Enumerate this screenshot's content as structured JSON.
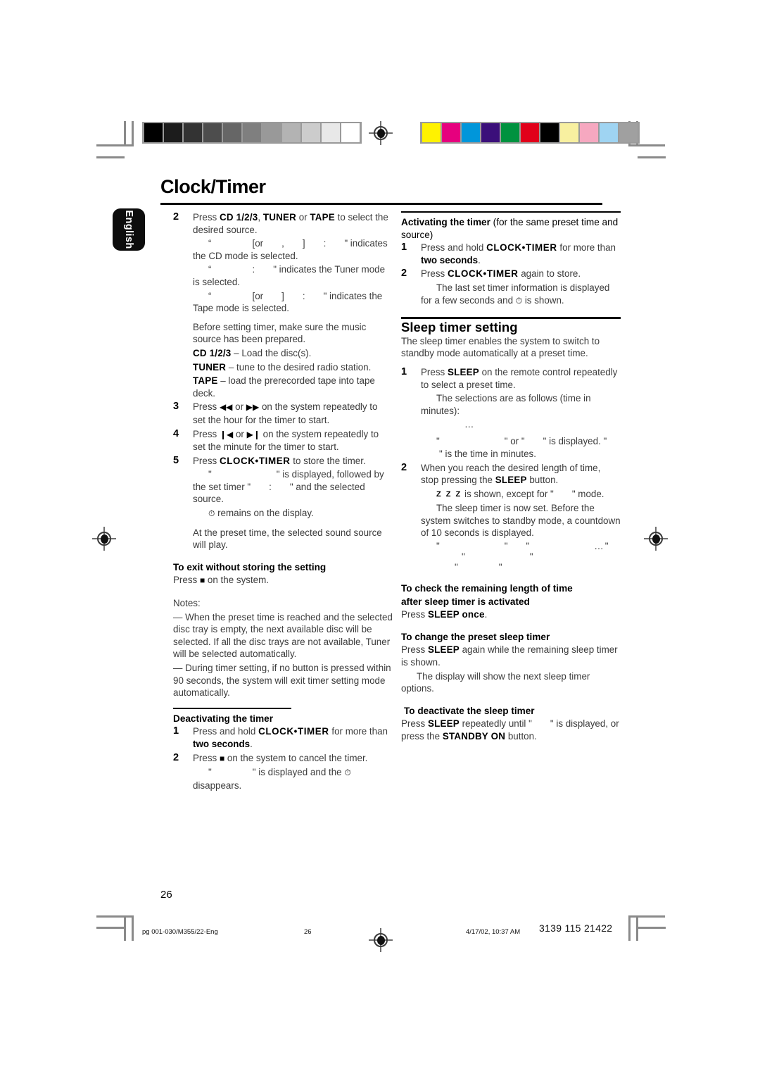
{
  "document": {
    "title": "Clock/Timer",
    "language_tab": "English",
    "page_number": "26"
  },
  "calibration": {
    "grayscale": [
      "#000000",
      "#1c1c1c",
      "#333333",
      "#4d4d4d",
      "#666666",
      "#7f7f7f",
      "#999999",
      "#b3b3b3",
      "#cccccc",
      "#e8e8e8",
      "#ffffff"
    ],
    "colors": [
      "#fff200",
      "#e6007e",
      "#0096da",
      "#3b0f7a",
      "#00923f",
      "#e1001a",
      "#000000",
      "#f8f0a0",
      "#f6a8c0",
      "#9fd4f2",
      "#a0a0a0"
    ]
  },
  "left_column": {
    "step2": {
      "num": "2",
      "line1_pre": "Press ",
      "kb_cd": "CD 1/2/3",
      "sep1": ", ",
      "kb_tuner": "TUNER",
      "sep2": " or ",
      "kb_tape": "TAPE",
      "line1_post": " to select the desired source.",
      "cd_note_pre": "“",
      "cd_note_mid": "[or",
      "cd_note_comma": ",",
      "cd_note_close": "]",
      "cd_note_colon": ":",
      "cd_note_post": "\" indicates the CD mode is selected.",
      "tuner_note_pre": "“",
      "tuner_note_colon": ":",
      "tuner_note_post": "\" indicates the Tuner mode is selected.",
      "tape_note_pre": "“",
      "tape_note_mid": "[or",
      "tape_note_close": "]",
      "tape_note_colon": ":",
      "tape_note_post": "\" indicates the Tape mode is selected.",
      "before_text": "Before setting timer, make sure the music source has been prepared.",
      "src_cd_kb": "CD 1/2/3",
      "src_cd_txt": " – Load the disc(s).",
      "src_tuner_kb": "TUNER",
      "src_tuner_txt": " – tune to the desired radio station.",
      "src_tape_kb": "TAPE",
      "src_tape_txt": " – load the prerecorded tape into tape deck."
    },
    "step3": {
      "num": "3",
      "pre": "Press ",
      "icon_rew": "◀◀",
      "mid": " or ",
      "icon_ff": "▶▶",
      "post": " on the system repeatedly to set the hour for the timer to start."
    },
    "step4": {
      "num": "4",
      "pre": "Press ",
      "icon_prev": "❙◀",
      "mid": " or ",
      "icon_next": "▶❙",
      "post": " on the system repeatedly to set the minute for the timer to start."
    },
    "step5": {
      "num": "5",
      "pre": "Press ",
      "kb": "CLOCK•TIMER",
      "post": " to store the timer.",
      "disp_pre": "\"",
      "disp_post": "\" is displayed, followed by the set timer \"",
      "disp_colon": ":",
      "disp_end": "\" and the selected source.",
      "clock_icon": "⏱",
      "clock_text": " remains on the display.",
      "preset_text": "At the preset time, the selected sound source will play."
    },
    "exit_heading": "To exit without storing the setting",
    "exit_pre": "Press ",
    "exit_icon": "■",
    "exit_post": " on the system.",
    "notes_label": "Notes:",
    "note1": "—  When the preset time is reached and the selected disc tray is empty, the next available disc will be selected.  If all the disc trays are not available, Tuner will be selected automatically.",
    "note2": "—  During timer setting, if no button is pressed within 90 seconds, the system will exit timer setting mode automatically.",
    "deactivating_heading": "Deactivating the timer",
    "deact1": {
      "num": "1",
      "pre": "Press and hold ",
      "kb": "CLOCK•TIMER",
      "mid": " for more than ",
      "bold": "two seconds",
      "post": "."
    },
    "deact2": {
      "num": "2",
      "pre": "Press ",
      "icon": "■",
      "post": " on the system to cancel the timer.",
      "disp_pre": "\"",
      "disp_post": "\" is displayed and the ",
      "clock_icon": "⏱",
      "disp_end": " disappears."
    }
  },
  "right_column": {
    "activating_heading_bold": "Activating the timer",
    "activating_heading_rest": " (for the same preset time and source)",
    "act1": {
      "num": "1",
      "pre": "Press and hold ",
      "kb": "CLOCK•TIMER",
      "mid": " for more than ",
      "bold": "two seconds",
      "post": "."
    },
    "act2": {
      "num": "2",
      "pre": "Press ",
      "kb": "CLOCK•TIMER",
      "post": " again to store.",
      "sub_pre": "The last set timer information is displayed for a few seconds and ",
      "clock_icon": "⏱",
      "sub_post": " is shown."
    },
    "sleep_heading": "Sleep timer setting",
    "sleep_intro": "The sleep timer enables the system to switch to standby mode automatically at a preset time.",
    "sleep1": {
      "num": "1",
      "pre": "Press ",
      "kb": "SLEEP",
      "post": " on the remote control repeatedly to select a preset time.",
      "sub": "The selections are as follows (time in minutes):",
      "dots": "…",
      "disp_pre": "\"",
      "disp_or": "\" or \"",
      "disp_mid": "\" is displayed. \"",
      "disp_post": "\" is the time in minutes."
    },
    "sleep2": {
      "num": "2",
      "pre": "When you reach the desired length of time, stop pressing the ",
      "kb": "SLEEP",
      "post": " button.",
      "zzz": "Z Z Z",
      "zzz_pre": " is shown, except for \"",
      "zzz_post": "\" mode.",
      "sub": "The sleep timer is now set. Before the system switches to standby mode, a countdown of 10 seconds is displayed.",
      "seq_q": "\""
    },
    "check_heading_l1": "To check the remaining length of time",
    "check_heading_l2": "after sleep timer is activated",
    "check_pre": "Press ",
    "check_kb": "SLEEP once",
    "check_post": ".",
    "change_heading": "To change the preset sleep timer",
    "change_pre": "Press ",
    "change_kb": "SLEEP",
    "change_post": " again while the remaining sleep timer is shown.",
    "change_sub": "The display will show the next sleep timer options.",
    "deact_heading": "To deactivate the sleep timer",
    "deact_pre": "Press ",
    "deact_kb": "SLEEP",
    "deact_mid": " repeatedly until \"",
    "deact_post": "\" is displayed, or press the ",
    "deact_kb2": "STANDBY ON",
    "deact_end": " button."
  },
  "footer": {
    "file": "pg 001-030/M355/22-Eng",
    "page": "26",
    "timestamp": "4/17/02, 10:37 AM",
    "code": "3139 115 21422"
  }
}
